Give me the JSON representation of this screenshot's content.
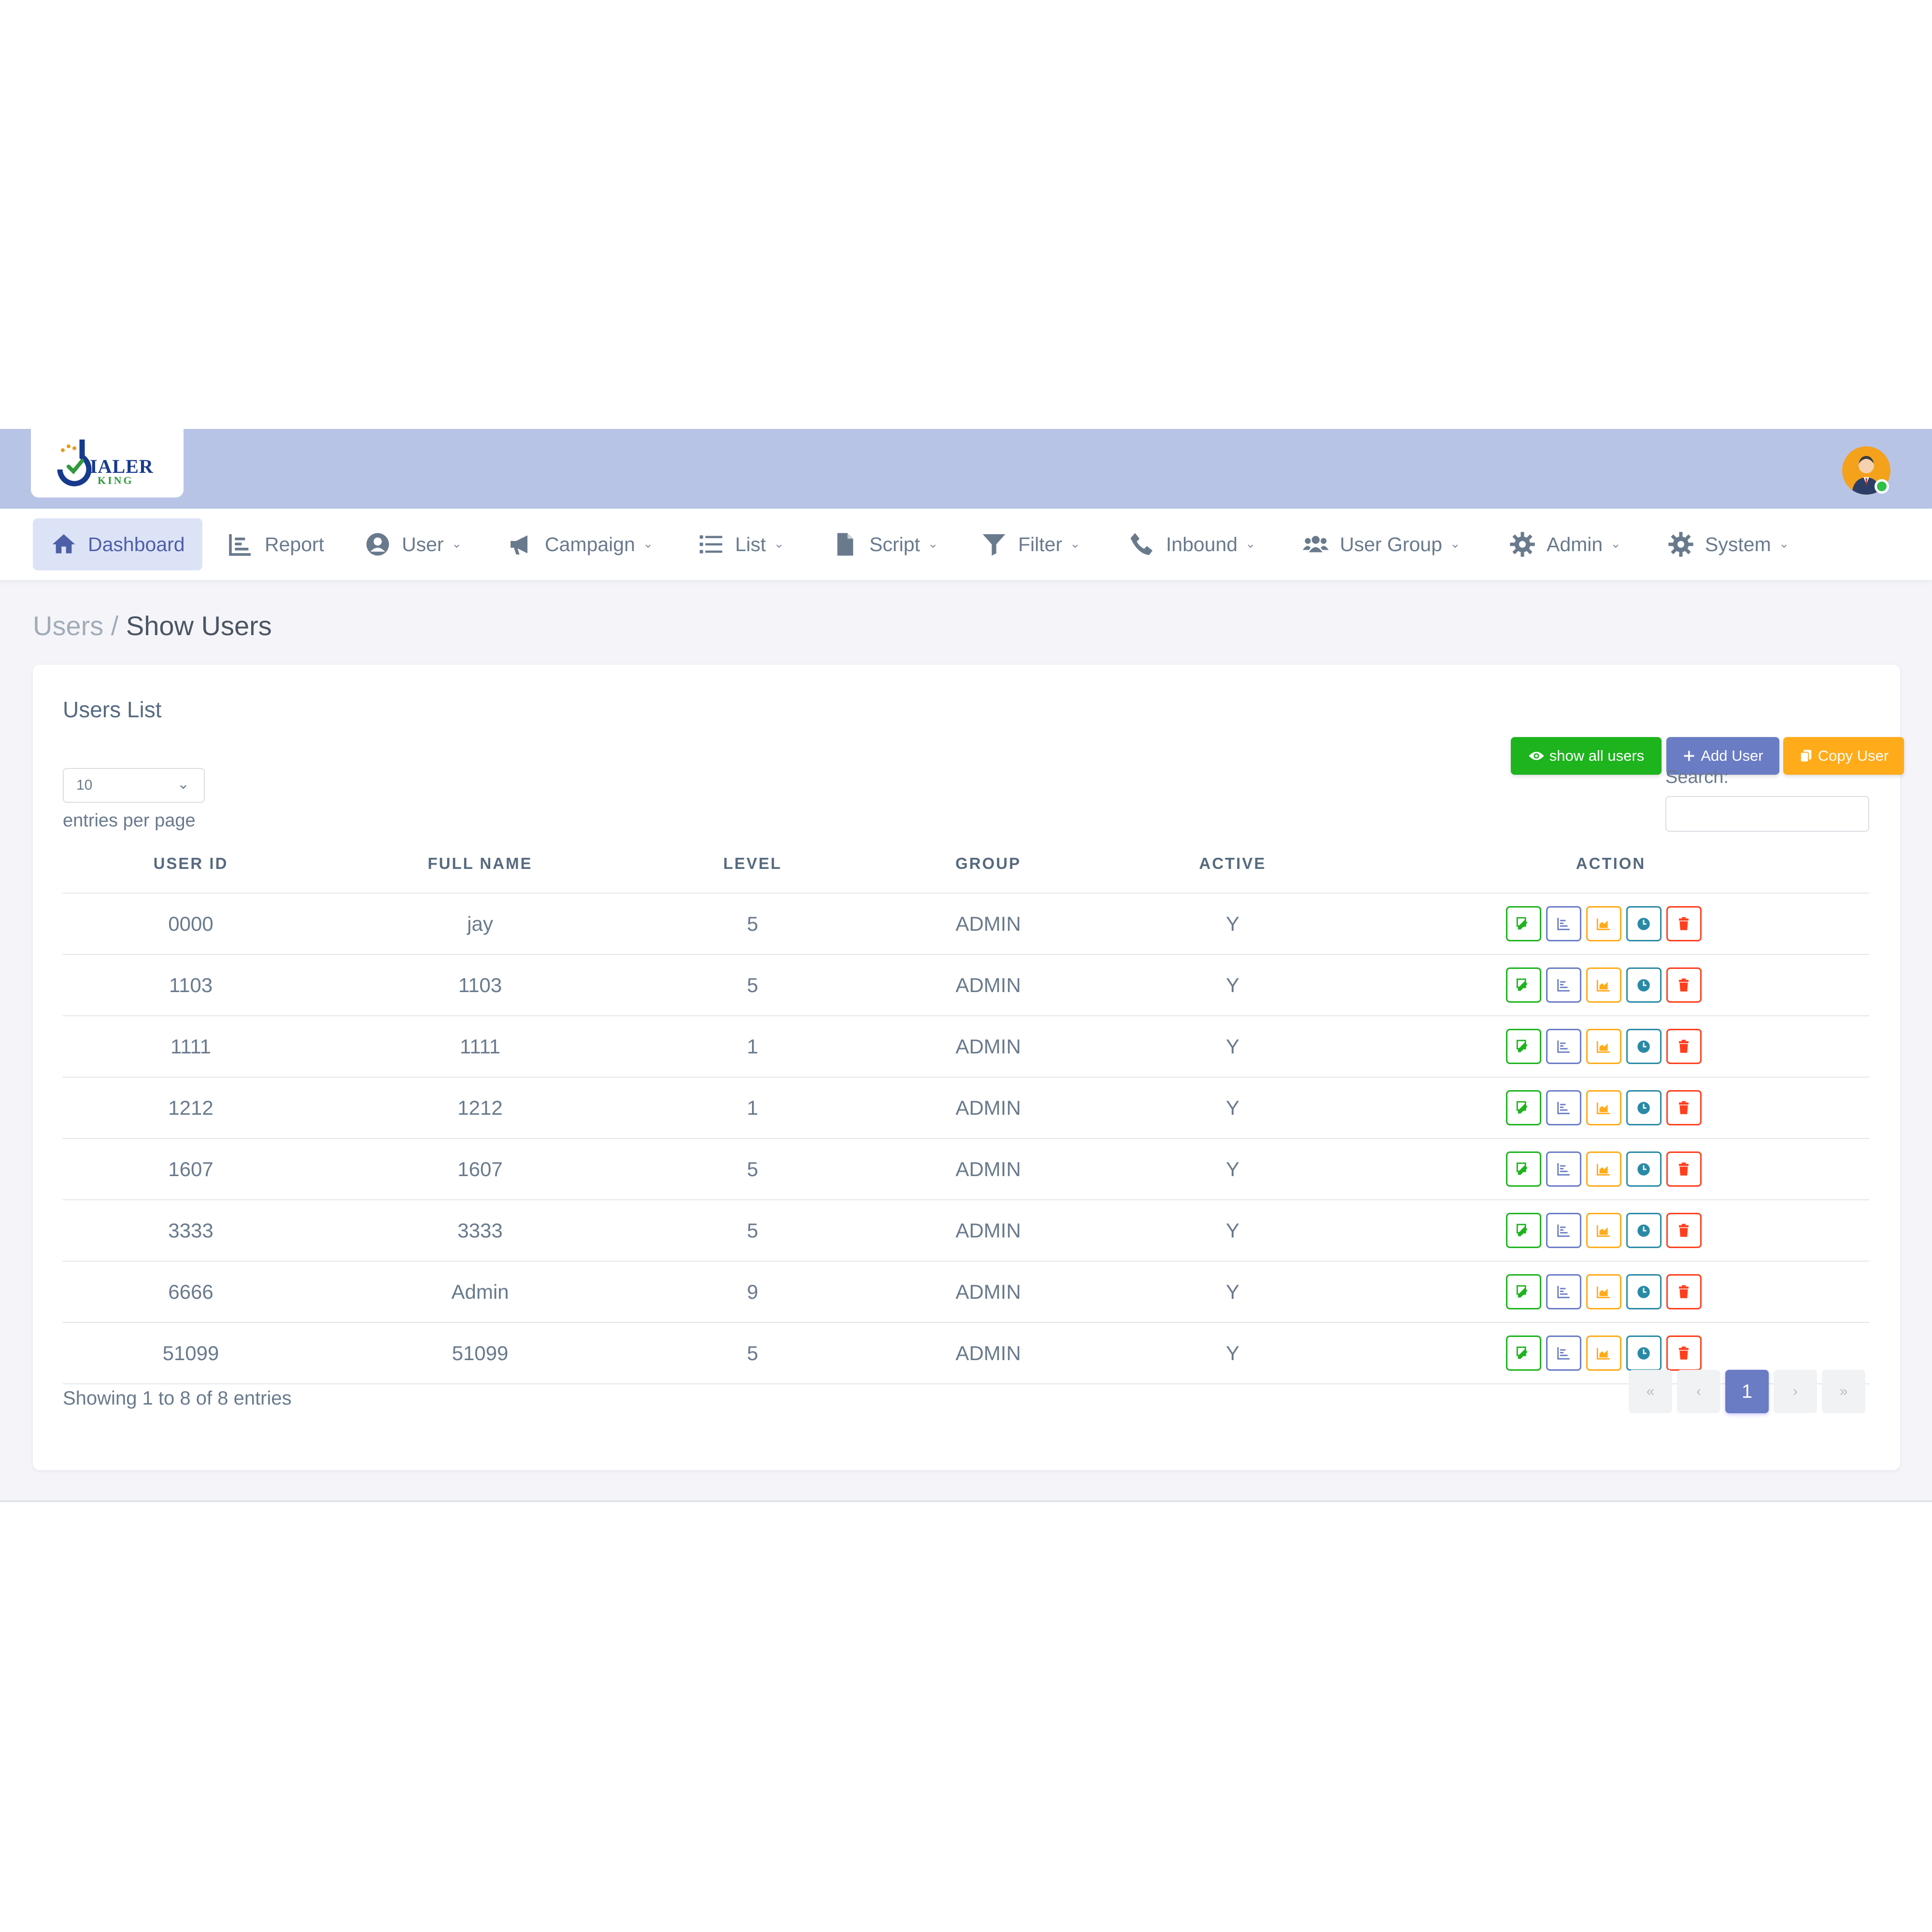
{
  "brand": {
    "logo_word": "IALER",
    "logo_sub": "KING"
  },
  "nav": {
    "items": [
      {
        "label": "Dashboard",
        "icon": "home-icon",
        "active": true
      },
      {
        "label": "Report",
        "icon": "chart-bar-icon"
      },
      {
        "label": "User",
        "icon": "user-circle-icon"
      },
      {
        "label": "Campaign",
        "icon": "megaphone-icon"
      },
      {
        "label": "List",
        "icon": "list-icon"
      },
      {
        "label": "Script",
        "icon": "file-icon"
      },
      {
        "label": "Filter",
        "icon": "filter-icon"
      },
      {
        "label": "Inbound",
        "icon": "phone-icon"
      },
      {
        "label": "User Group",
        "icon": "users-icon"
      },
      {
        "label": "Admin",
        "icon": "gear-icon"
      },
      {
        "label": "System",
        "icon": "gear-icon"
      }
    ]
  },
  "breadcrumb": {
    "parent": "Users /",
    "current": "Show Users"
  },
  "card": {
    "title": "Users List",
    "buttons": {
      "show_all": "show all users",
      "add_user": "Add User",
      "copy_user": "Copy User"
    },
    "length": {
      "value": "10",
      "label": "entries per page"
    },
    "search": {
      "label": "Search:",
      "value": ""
    },
    "table": {
      "headers": [
        "User ID",
        "Full Name",
        "Level",
        "Group",
        "Active",
        "Action"
      ],
      "rows": [
        [
          "0000",
          "jay",
          "5",
          "ADMIN",
          "Y"
        ],
        [
          "1103",
          "1103",
          "5",
          "ADMIN",
          "Y"
        ],
        [
          "1111",
          "1111",
          "1",
          "ADMIN",
          "Y"
        ],
        [
          "1212",
          "1212",
          "1",
          "ADMIN",
          "Y"
        ],
        [
          "1607",
          "1607",
          "5",
          "ADMIN",
          "Y"
        ],
        [
          "3333",
          "3333",
          "5",
          "ADMIN",
          "Y"
        ],
        [
          "6666",
          "Admin",
          "9",
          "ADMIN",
          "Y"
        ],
        [
          "51099",
          "51099",
          "5",
          "ADMIN",
          "Y"
        ]
      ],
      "action_icons": [
        "edit-icon",
        "stats-icon",
        "area-chart-icon",
        "clock-icon",
        "trash-icon"
      ]
    },
    "footer": {
      "info": "Showing 1 to 8 of 8 entries"
    },
    "pager": {
      "first": "«",
      "prev": "‹",
      "current": "1",
      "next": "›",
      "last": "»"
    }
  },
  "colors": {
    "topbar": "#b8c4e6",
    "primary": "#6a7cc4",
    "success": "#1db41d",
    "warning": "#ffab1a",
    "info": "#2a8aa6",
    "danger": "#ff3e1d"
  }
}
